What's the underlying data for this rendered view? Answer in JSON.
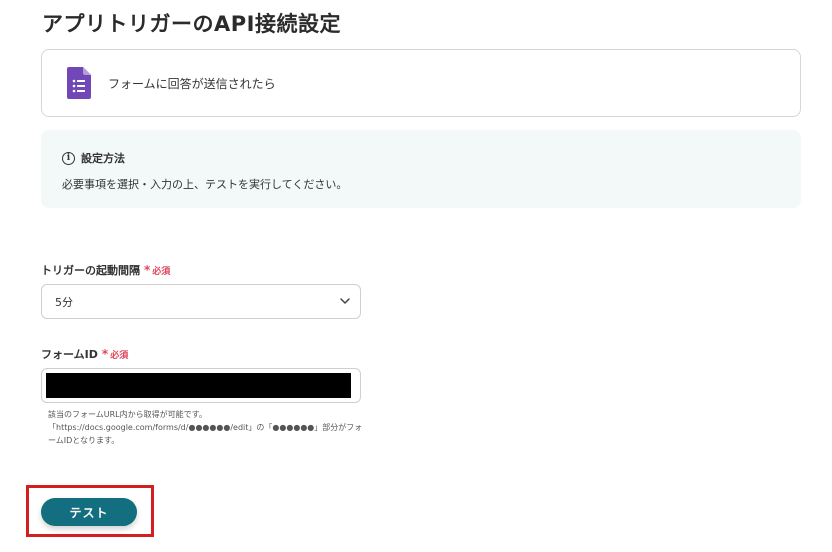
{
  "page": {
    "title": "アプリトリガーのAPI接続設定"
  },
  "app_card": {
    "label": "フォームに回答が送信されたら",
    "icon": "google-forms-icon"
  },
  "info": {
    "title": "設定方法",
    "text": "必要事項を選択・入力の上、テストを実行してください。"
  },
  "fields": {
    "interval": {
      "label": "トリガーの起動間隔",
      "required_mark": "*",
      "required_text": "必須",
      "value": "5分"
    },
    "form_id": {
      "label": "フォームID",
      "required_mark": "*",
      "required_text": "必須",
      "value": ""
    }
  },
  "help": {
    "line1": "該当のフォームURL内から取得が可能です。",
    "line2": "「https://docs.google.com/forms/d/●●●●●●/edit」の「●●●●●●」部分がフォ",
    "line3": "ームIDとなります。"
  },
  "actions": {
    "test_label": "テスト"
  },
  "colors": {
    "accent": "#136e80",
    "required": "#e0455a",
    "highlight": "#d21f1f",
    "info_bg": "#f2f9f8"
  }
}
